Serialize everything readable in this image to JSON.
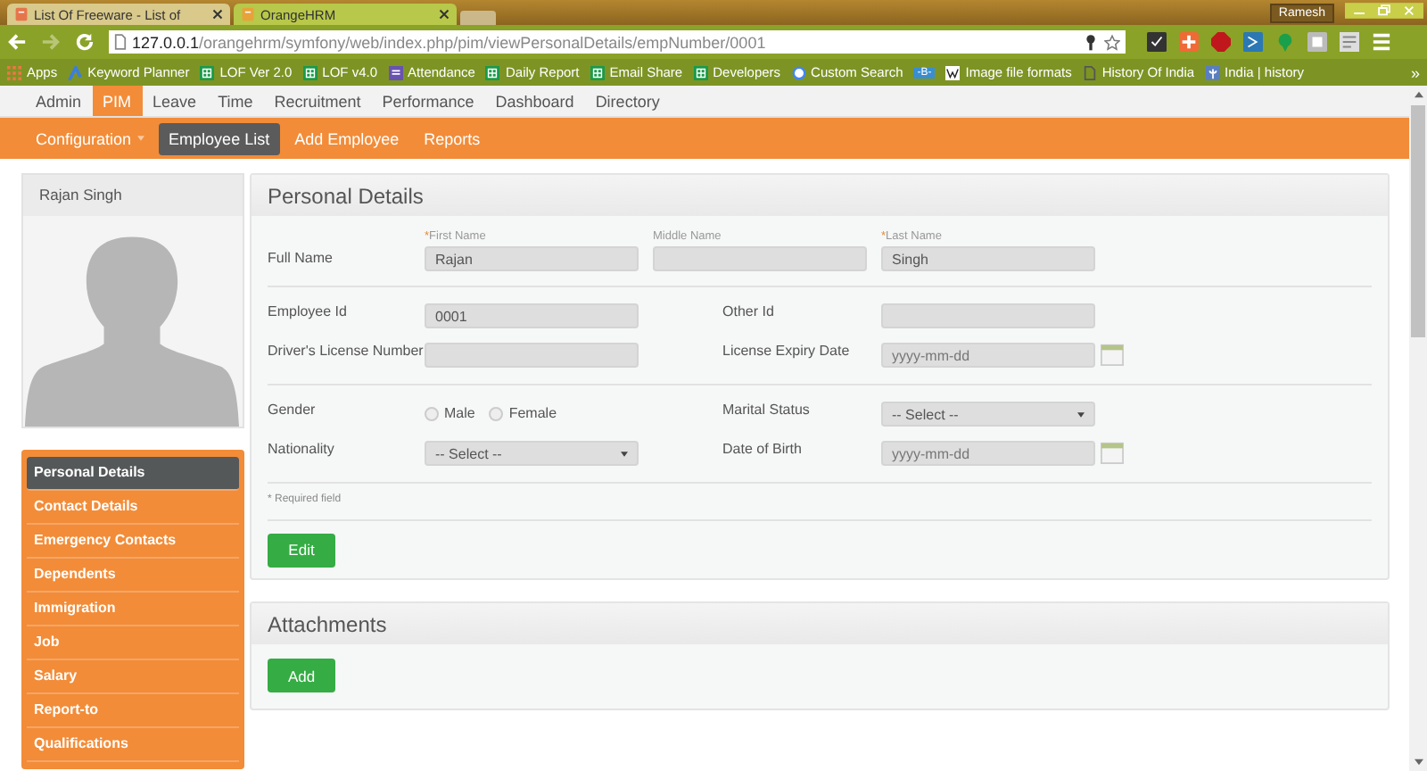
{
  "browser": {
    "tabs": [
      {
        "title": "List Of Freeware - List of",
        "selected": false
      },
      {
        "title": "OrangeHRM",
        "selected": true
      }
    ],
    "profile": "Ramesh",
    "url_host": "127.0.0.1",
    "url_path": "/orangehrm/symfony/web/index.php/pim/viewPersonalDetails/empNumber/0001",
    "bookmarks": [
      {
        "label": "Apps",
        "kind": "apps"
      },
      {
        "label": "Keyword Planner",
        "kind": "ads"
      },
      {
        "label": "LOF Ver 2.0",
        "kind": "sheet"
      },
      {
        "label": "LOF v4.0",
        "kind": "sheet"
      },
      {
        "label": "Attendance",
        "kind": "form"
      },
      {
        "label": "Daily Report",
        "kind": "sheet"
      },
      {
        "label": "Email Share",
        "kind": "sheet"
      },
      {
        "label": "Developers",
        "kind": "sheet"
      },
      {
        "label": "Custom Search",
        "kind": "google"
      },
      {
        "label": "-B-",
        "kind": "badge"
      },
      {
        "label": "Image file formats",
        "kind": "wiki"
      },
      {
        "label": "History Of India",
        "kind": "page"
      },
      {
        "label": "India | history",
        "kind": "flag"
      }
    ],
    "more": "»"
  },
  "main_menu": [
    {
      "label": "Admin",
      "selected": false
    },
    {
      "label": "PIM",
      "selected": true
    },
    {
      "label": "Leave",
      "selected": false
    },
    {
      "label": "Time",
      "selected": false
    },
    {
      "label": "Recruitment",
      "selected": false
    },
    {
      "label": "Performance",
      "selected": false
    },
    {
      "label": "Dashboard",
      "selected": false
    },
    {
      "label": "Directory",
      "selected": false
    }
  ],
  "sub_menu": [
    {
      "label": "Configuration",
      "selected": false,
      "dropdown": true
    },
    {
      "label": "Employee List",
      "selected": true,
      "dropdown": false
    },
    {
      "label": "Add Employee",
      "selected": false,
      "dropdown": false
    },
    {
      "label": "Reports",
      "selected": false,
      "dropdown": false
    }
  ],
  "employee": {
    "name": "Rajan Singh"
  },
  "side_menu": [
    {
      "label": "Personal Details",
      "selected": true
    },
    {
      "label": "Contact Details",
      "selected": false
    },
    {
      "label": "Emergency Contacts",
      "selected": false
    },
    {
      "label": "Dependents",
      "selected": false
    },
    {
      "label": "Immigration",
      "selected": false
    },
    {
      "label": "Job",
      "selected": false
    },
    {
      "label": "Salary",
      "selected": false
    },
    {
      "label": "Report-to",
      "selected": false
    },
    {
      "label": "Qualifications",
      "selected": false
    }
  ],
  "personal_details": {
    "title": "Personal Details",
    "full_name_label": "Full Name",
    "required_mark": "*",
    "name_fields": [
      {
        "label": "First Name",
        "required": true,
        "value": "Rajan"
      },
      {
        "label": "Middle Name",
        "required": false
      },
      {
        "label": "Last Name",
        "required": true,
        "value": "Singh"
      }
    ],
    "rows": [
      [
        {
          "label": "Employee Id",
          "kind": "text",
          "value": "0001"
        },
        {
          "label": "Other Id",
          "kind": "text"
        }
      ],
      [
        {
          "label": "Driver's License Number",
          "kind": "text"
        },
        {
          "label": "License Expiry Date",
          "kind": "date",
          "placeholder": "yyyy-mm-dd"
        }
      ],
      [
        {
          "label": "Gender",
          "kind": "radio",
          "options": [
            {
              "label": "Male",
              "selected": false
            },
            {
              "label": "Female",
              "selected": false
            }
          ]
        },
        {
          "label": "Marital Status",
          "kind": "select",
          "value": "-- Select --"
        }
      ],
      [
        {
          "label": "Nationality",
          "kind": "select",
          "value": "-- Select --"
        },
        {
          "label": "Date of Birth",
          "kind": "date",
          "placeholder": "yyyy-mm-dd"
        }
      ]
    ],
    "required_note": "* Required field",
    "button": "Edit"
  },
  "attachments": {
    "title": "Attachments",
    "button": "Add"
  }
}
